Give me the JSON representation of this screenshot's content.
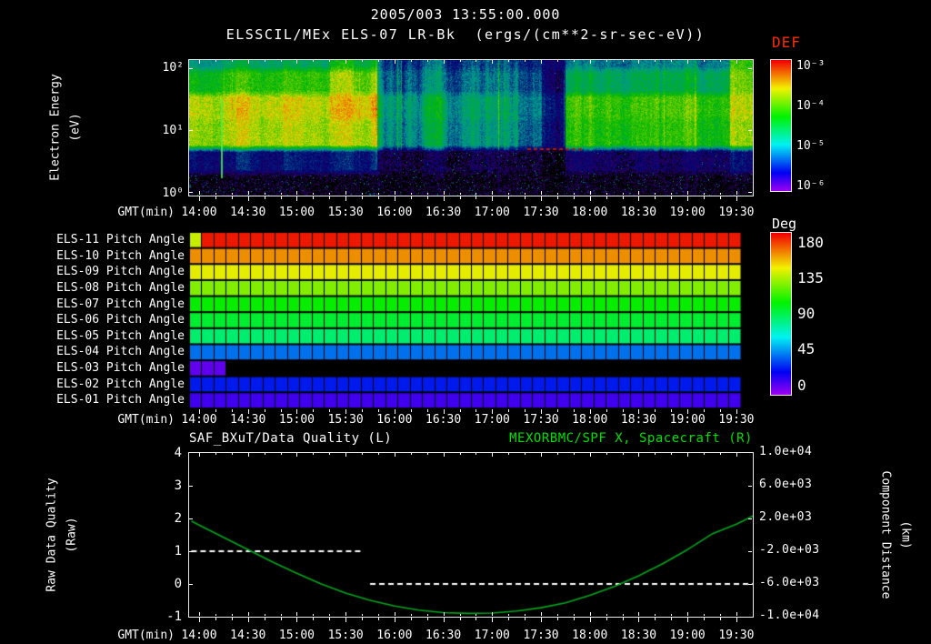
{
  "header": {
    "title": "2005/003 13:55:00.000",
    "subtitle": "ELSSCIL/MEx ELS-07 LR-Bk  (ergs/(cm**2-sr-sec-eV))"
  },
  "time_axis": {
    "label": "GMT(min)",
    "ticks": [
      "14:00",
      "14:30",
      "15:00",
      "15:30",
      "16:00",
      "16:30",
      "17:00",
      "17:30",
      "18:00",
      "18:30",
      "19:00",
      "19:30"
    ]
  },
  "spectrogram_panel": {
    "ylabel_line1": "Electron Energy",
    "ylabel_line2": "(eV)",
    "ytick_labels": [
      "10²",
      "10¹",
      "10⁰"
    ],
    "colorbar_title": "DEF",
    "colorbar_title_color": "#ff2a00",
    "colorbar_ticks": [
      "10⁻³",
      "10⁻⁴",
      "10⁻⁵",
      "10⁻⁶"
    ]
  },
  "pitch_panel": {
    "colorbar_title": "Deg",
    "colorbar_ticks": [
      "180",
      "135",
      "90",
      "45",
      "0"
    ]
  },
  "quality_panel": {
    "left_title": "SAF_BXuT/Data Quality (L)",
    "right_title": "MEXORBMC/SPF X, Spacecraft (R)",
    "right_title_color": "#00e000",
    "ylabel_line1": "Raw Data Quality",
    "ylabel_line2": "(Raw)",
    "left_ticks": [
      "4",
      "3",
      "2",
      "1",
      "0",
      "-1"
    ],
    "right_label_line1": "Component Distance",
    "right_label_line2": "(km)",
    "right_ticks": [
      "1.0e+04",
      "6.0e+03",
      "2.0e+03",
      "-2.0e+03",
      "-6.0e+03",
      "-1.0e+04"
    ]
  },
  "chart_data": [
    {
      "type": "heatmap",
      "name": "electron_energy_spectrogram",
      "title": "ELSSCIL/MEx ELS-07 LR-Bk",
      "value_units": "ergs/(cm**2-sr-sec-eV)",
      "x_start_gmt": "13:55",
      "x_end_gmt": "19:40",
      "y_scale": "log",
      "y_range_ev": [
        1,
        140
      ],
      "value_scale": "log",
      "value_range": [
        1e-06,
        0.001
      ],
      "energy_bins_ev_high_to_low": [
        [
          100,
          140
        ],
        [
          40,
          100
        ],
        [
          15,
          40
        ],
        [
          5,
          15
        ],
        [
          2,
          5
        ],
        [
          1,
          2
        ]
      ],
      "time_bins": 24,
      "log10_flux": [
        [
          -4.8,
          -4.8,
          -4.7,
          -4.8,
          -4.7,
          -4.6,
          -4.3,
          -4.5,
          -5.2,
          -5.3,
          -5.2,
          -5.3,
          -5.2,
          -5.3,
          -5.4,
          -5.6,
          -5.1,
          -5.0,
          -5.1,
          -5.0,
          -5.1,
          -5.0,
          -4.9,
          -4.1
        ],
        [
          -4.3,
          -4.3,
          -4.2,
          -4.3,
          -4.2,
          -4.1,
          -3.8,
          -4.0,
          -5.0,
          -5.1,
          -5.0,
          -5.1,
          -5.0,
          -5.1,
          -5.2,
          -5.5,
          -4.7,
          -4.6,
          -4.7,
          -4.6,
          -4.7,
          -4.6,
          -4.5,
          -3.9
        ],
        [
          -3.7,
          -3.8,
          -3.7,
          -3.8,
          -3.7,
          -3.7,
          -3.5,
          -3.6,
          -4.7,
          -4.8,
          -4.6,
          -4.8,
          -4.7,
          -4.8,
          -5.0,
          -5.3,
          -4.2,
          -4.1,
          -4.2,
          -4.1,
          -4.2,
          -4.1,
          -4.1,
          -3.7
        ],
        [
          -3.8,
          -3.9,
          -3.8,
          -3.9,
          -3.8,
          -3.8,
          -3.7,
          -3.8,
          -4.8,
          -4.9,
          -4.7,
          -4.9,
          -4.8,
          -4.9,
          -5.1,
          -5.4,
          -4.3,
          -4.2,
          -4.3,
          -4.2,
          -4.3,
          -4.2,
          -4.2,
          -3.8
        ],
        [
          -5.5,
          -5.6,
          -5.5,
          -5.6,
          -5.5,
          -5.5,
          -5.4,
          -5.5,
          -5.8,
          -5.9,
          -5.8,
          -5.9,
          -5.8,
          -5.9,
          -5.9,
          -6.0,
          -5.7,
          -5.7,
          -5.8,
          -5.7,
          -5.8,
          -5.7,
          -5.7,
          -5.5
        ],
        [
          -6.0,
          -6.0,
          -6.0,
          -6.0,
          -6.0,
          -6.0,
          -6.0,
          -6.0,
          -6.0,
          -6.0,
          -6.0,
          -6.0,
          -6.0,
          -6.0,
          -6.0,
          -6.0,
          -6.0,
          -6.0,
          -6.0,
          -6.0,
          -6.0,
          -6.0,
          -6.0,
          -6.0
        ]
      ]
    },
    {
      "type": "heatmap",
      "name": "pitch_angles",
      "value_units": "deg",
      "angle_range": [
        0,
        180
      ],
      "cells": 46,
      "rows": [
        {
          "label": "ELS-11 Pitch Angle",
          "segments": [
            {
              "from_cell": 0,
              "to_cell": 1,
              "angle": 135
            },
            {
              "from_cell": 1,
              "to_cell": 45,
              "angle": 176
            }
          ]
        },
        {
          "label": "ELS-10 Pitch Angle",
          "segments": [
            {
              "from_cell": 0,
              "to_cell": 45,
              "angle": 157
            }
          ]
        },
        {
          "label": "ELS-09 Pitch Angle",
          "segments": [
            {
              "from_cell": 0,
              "to_cell": 45,
              "angle": 140
            }
          ]
        },
        {
          "label": "ELS-08 Pitch Angle",
          "segments": [
            {
              "from_cell": 0,
              "to_cell": 45,
              "angle": 124
            }
          ]
        },
        {
          "label": "ELS-07 Pitch Angle",
          "segments": [
            {
              "from_cell": 0,
              "to_cell": 45,
              "angle": 104
            }
          ]
        },
        {
          "label": "ELS-06 Pitch Angle",
          "segments": [
            {
              "from_cell": 0,
              "to_cell": 45,
              "angle": 95
            }
          ]
        },
        {
          "label": "ELS-05 Pitch Angle",
          "segments": [
            {
              "from_cell": 0,
              "to_cell": 45,
              "angle": 85
            }
          ]
        },
        {
          "label": "ELS-04 Pitch Angle",
          "segments": [
            {
              "from_cell": 0,
              "to_cell": 45,
              "angle": 44
            }
          ]
        },
        {
          "label": "ELS-03 Pitch Angle",
          "segments": [
            {
              "from_cell": 0,
              "to_cell": 3,
              "angle": 10
            }
          ]
        },
        {
          "label": "ELS-02 Pitch Angle",
          "segments": [
            {
              "from_cell": 0,
              "to_cell": 45,
              "angle": 30
            }
          ]
        },
        {
          "label": "ELS-01 Pitch Angle",
          "segments": [
            {
              "from_cell": 0,
              "to_cell": 45,
              "angle": 15
            }
          ]
        }
      ]
    },
    {
      "type": "line",
      "name": "quality_and_spacecraft_distance",
      "x_unit": "gmt_decimal_hours",
      "left_axis_range": [
        -1,
        4
      ],
      "right_axis_range": [
        -10000,
        10000
      ],
      "series": [
        {
          "name": "SAF_BXuT/Data Quality",
          "axis": "left",
          "color": "#ffffff",
          "style": "dashed",
          "segments": [
            {
              "points": [
                [
                  13.92,
                  1
                ],
                [
                  15.67,
                  1
                ]
              ]
            },
            {
              "points": [
                [
                  15.75,
                  0
                ],
                [
                  19.67,
                  0
                ]
              ]
            }
          ]
        },
        {
          "name": "MEXORBMC/SPF X, Spacecraft",
          "axis": "right",
          "color": "#00a81e",
          "style": "solid",
          "points": [
            [
              13.92,
              1700
            ],
            [
              14.0,
              1200
            ],
            [
              14.25,
              -300
            ],
            [
              14.5,
              -1800
            ],
            [
              14.75,
              -3300
            ],
            [
              15.0,
              -4700
            ],
            [
              15.25,
              -6000
            ],
            [
              15.5,
              -7100
            ],
            [
              15.75,
              -8000
            ],
            [
              16.0,
              -8700
            ],
            [
              16.25,
              -9200
            ],
            [
              16.5,
              -9500
            ],
            [
              16.75,
              -9600
            ],
            [
              17.0,
              -9550
            ],
            [
              17.25,
              -9300
            ],
            [
              17.5,
              -8900
            ],
            [
              17.75,
              -8300
            ],
            [
              18.0,
              -7400
            ],
            [
              18.25,
              -6300
            ],
            [
              18.5,
              -5000
            ],
            [
              18.75,
              -3500
            ],
            [
              19.0,
              -1800
            ],
            [
              19.25,
              100
            ],
            [
              19.5,
              1300
            ],
            [
              19.67,
              2300
            ]
          ]
        }
      ]
    }
  ]
}
